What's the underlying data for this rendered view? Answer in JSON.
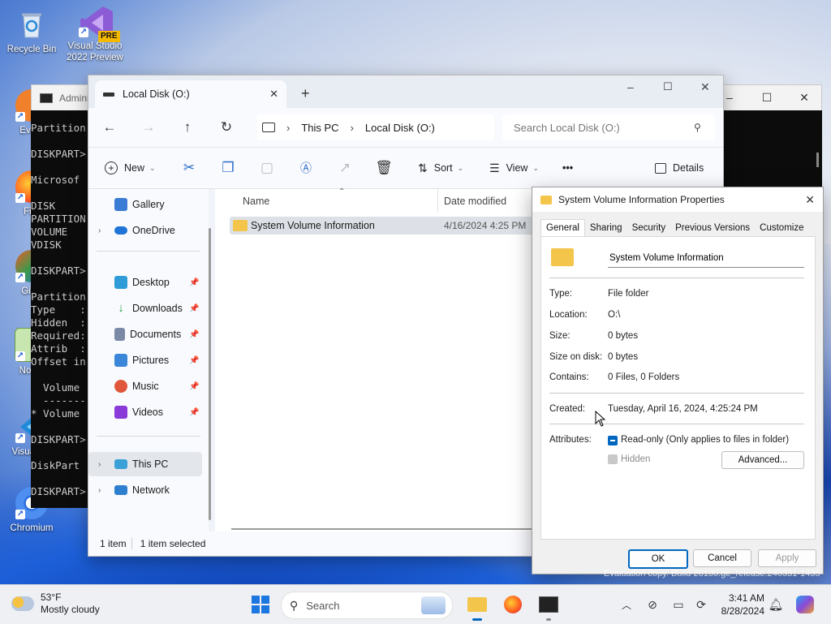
{
  "desktop": {
    "icons": [
      {
        "label": "Recycle Bin"
      },
      {
        "label": "Visual Studio 2022 Preview",
        "badge": "PRE"
      },
      {
        "label": "Every"
      },
      {
        "label": "Fire"
      },
      {
        "label": "Git B"
      },
      {
        "label": "Notep"
      },
      {
        "label": "Visual Co"
      },
      {
        "label": "Chromium"
      }
    ],
    "watermark": "Evaluation copy. Build 26100.ge_release.240331-1435"
  },
  "cmd": {
    "title": "Admini",
    "lines": [
      "Partition",
      "",
      "DISKPART>",
      "",
      "Microsof",
      "",
      "DISK",
      "PARTITION",
      "VOLUME",
      "VDISK",
      "",
      "DISKPART>",
      "",
      "Partition",
      "Type    :",
      "Hidden  :",
      "Required:",
      "Attrib  :",
      "Offset in",
      "",
      "  Volume",
      "  -------",
      "* Volume",
      "",
      "DISKPART>",
      "",
      "DiskPart",
      "",
      "DISKPART>"
    ]
  },
  "explorer": {
    "tab_title": "Local Disk (O:)",
    "new_tab": "+",
    "breadcrumb": [
      "This PC",
      "Local Disk (O:)"
    ],
    "search_placeholder": "Search Local Disk (O:)",
    "toolbar": {
      "new": "New",
      "sort": "Sort",
      "view": "View",
      "more": "•••",
      "details": "Details"
    },
    "sidebar": [
      {
        "label": "Gallery",
        "color": "#3a7bd5"
      },
      {
        "label": "OneDrive",
        "color": "#1f74d6"
      },
      {
        "label": "Desktop",
        "color": "#2f9bd8"
      },
      {
        "label": "Downloads",
        "color": "#2aa34a"
      },
      {
        "label": "Documents",
        "color": "#7a8aa6"
      },
      {
        "label": "Pictures",
        "color": "#3a86d8"
      },
      {
        "label": "Music",
        "color": "#e0563a"
      },
      {
        "label": "Videos",
        "color": "#8a3ad8"
      },
      {
        "label": "This PC",
        "color": "#3aa0d8"
      },
      {
        "label": "Network",
        "color": "#2f7fd0"
      }
    ],
    "columns": {
      "name": "Name",
      "date": "Date modified"
    },
    "files": [
      {
        "name": "System Volume Information",
        "date": "4/16/2024 4:25 PM"
      }
    ],
    "status": {
      "count": "1 item",
      "selected": "1 item selected"
    }
  },
  "properties": {
    "title": "System Volume Information Properties",
    "tabs": [
      "General",
      "Sharing",
      "Security",
      "Previous Versions",
      "Customize"
    ],
    "name_value": "System Volume Information",
    "rows": [
      {
        "label": "Type:",
        "value": "File folder"
      },
      {
        "label": "Location:",
        "value": "O:\\"
      },
      {
        "label": "Size:",
        "value": "0 bytes"
      },
      {
        "label": "Size on disk:",
        "value": "0 bytes"
      },
      {
        "label": "Contains:",
        "value": "0 Files, 0 Folders"
      }
    ],
    "created_label": "Created:",
    "created_value": "Tuesday, April 16, 2024, 4:25:24 PM",
    "attributes_label": "Attributes:",
    "readonly": "Read-only (Only applies to files in folder)",
    "hidden": "Hidden",
    "advanced": "Advanced...",
    "ok": "OK",
    "cancel": "Cancel",
    "apply": "Apply"
  },
  "taskbar": {
    "weather_temp": "53°F",
    "weather_desc": "Mostly cloudy",
    "search": "Search",
    "time": "3:41 AM",
    "date": "8/28/2024"
  },
  "colors": {
    "accent": "#0067c0",
    "folder": "#f3c54a"
  }
}
